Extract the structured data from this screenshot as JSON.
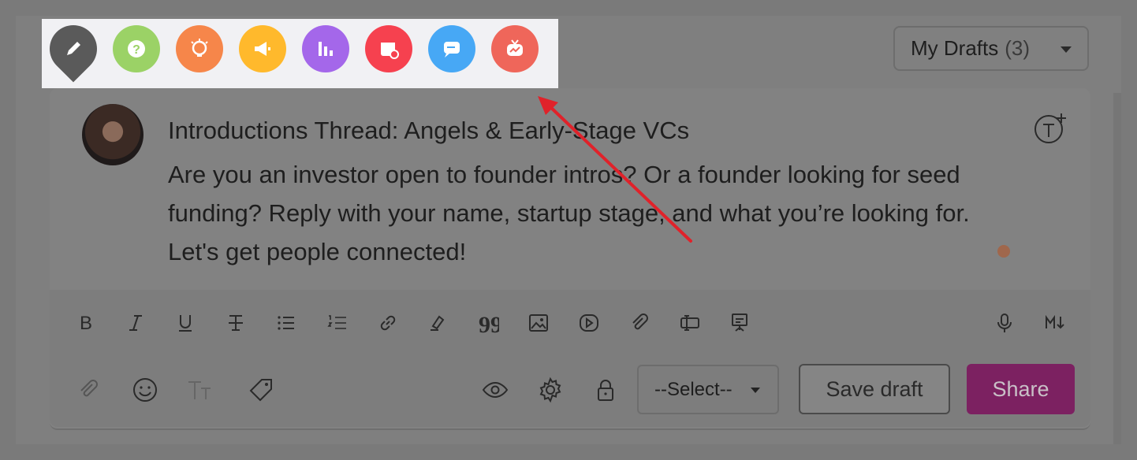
{
  "post_type_icons": [
    {
      "icon": "pencil-pin-icon",
      "color": "#5a5a5a"
    },
    {
      "icon": "question-icon",
      "color": "#9bd266"
    },
    {
      "icon": "lightbulb-icon",
      "color": "#f6864a"
    },
    {
      "icon": "megaphone-icon",
      "color": "#ffb92c"
    },
    {
      "icon": "poll-chart-icon",
      "color": "#a467ea"
    },
    {
      "icon": "event-calendar-icon",
      "color": "#f6414f"
    },
    {
      "icon": "chat-bubble-icon",
      "color": "#47a8f5"
    },
    {
      "icon": "live-tv-icon",
      "color": "#ef665a"
    }
  ],
  "drafts": {
    "label": "My Drafts",
    "count": "(3)"
  },
  "post": {
    "title": "Introductions Thread: Angels & Early-Stage VCs",
    "body": "Are you an investor open to founder intros? Or a founder looking for seed funding? Reply with your name, startup stage, and what you’re looking for. Let's get people connected!"
  },
  "formatting_tools": [
    "bold-icon",
    "italic-icon",
    "underline-icon",
    "strikethrough-icon",
    "bullet-list-icon",
    "numbered-list-icon",
    "link-icon",
    "highlight-icon",
    "quote-icon",
    "image-icon",
    "video-icon",
    "attachment-icon",
    "embed-icon",
    "presentation-icon",
    "microphone-icon",
    "markdown-icon"
  ],
  "footer": {
    "select_label": "--Select--",
    "save_label": "Save draft",
    "share_label": "Share"
  },
  "colors": {
    "accent": "#7c2161",
    "annotation_arrow": "#e0222a"
  }
}
